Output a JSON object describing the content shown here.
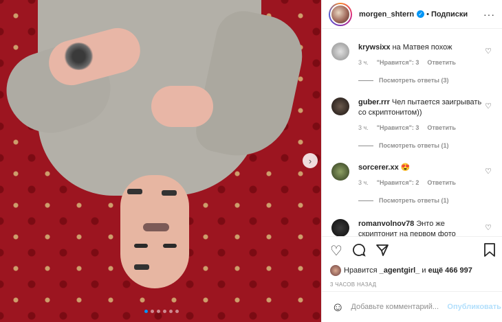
{
  "post": {
    "username": "morgen_shtern",
    "verified_mark": "✓",
    "separator": "•",
    "follow_label": "Подписки",
    "more_label": "···"
  },
  "comments": [
    {
      "user": "krywsixx",
      "text": "на Матвея похож",
      "time": "3 ч.",
      "likes": "\"Нравится\": 3",
      "reply": "Ответить",
      "view_replies": "Посмотреть ответы (3)",
      "avatar_color": "#c9c9c9"
    },
    {
      "user": "guber.rrr",
      "text": "Чел пытается заигрывать со скриптонитом))",
      "time": "3 ч.",
      "likes": "\"Нравится\": 3",
      "reply": "Ответить",
      "view_replies": "Посмотреть ответы (1)",
      "avatar_color": "#3a2f2a"
    },
    {
      "user": "sorcerer.xx",
      "text": "😍",
      "time": "3 ч.",
      "likes": "\"Нравится\": 2",
      "reply": "Ответить",
      "view_replies": "Посмотреть ответы (1)",
      "avatar_color": "#5b6b3a"
    },
    {
      "user": "romanvolnov78",
      "text": "Энто же скриптонит на первом фото",
      "time": "",
      "likes": "",
      "reply": "",
      "view_replies": "",
      "avatar_color": "#1e1e1e"
    }
  ],
  "actions": {
    "likes_prefix": "Нравится",
    "likes_user": "_agentgirl_",
    "likes_mid": "и",
    "likes_count": "ещё 466 997",
    "time_ago": "3 ЧАСОВ НАЗАД"
  },
  "composer": {
    "placeholder": "Добавьте комментарий...",
    "publish_label": "Опубликовать"
  },
  "carousel": {
    "next_label": "›",
    "slides": 6,
    "active_index": 0
  },
  "colors": {
    "accent": "#0095f6",
    "publish_disabled": "#b2dffc",
    "carpet": "#9c1520"
  }
}
